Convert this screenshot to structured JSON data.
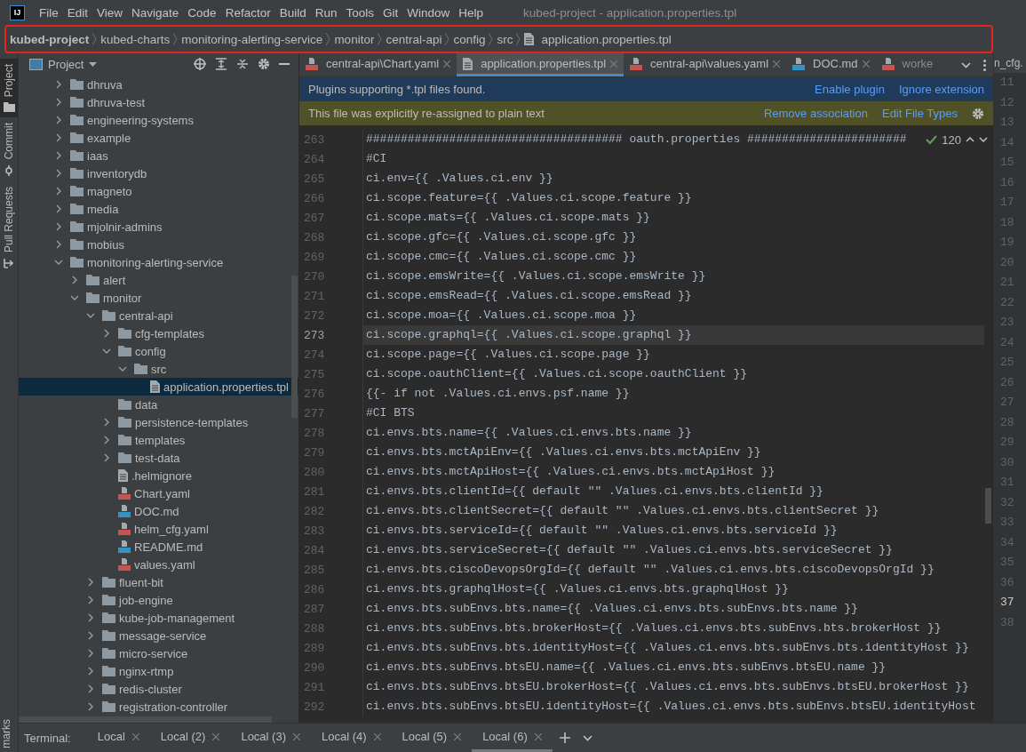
{
  "app_logo": "IJ",
  "menu": [
    "File",
    "Edit",
    "View",
    "Navigate",
    "Code",
    "Refactor",
    "Build",
    "Run",
    "Tools",
    "Git",
    "Window",
    "Help"
  ],
  "window": {
    "title": "kubed-project - application.properties.tpl"
  },
  "breadcrumb": [
    {
      "label": "kubed-project",
      "kind": "project"
    },
    {
      "label": "kubed-charts",
      "kind": "folder"
    },
    {
      "label": "monitoring-alerting-service",
      "kind": "folder"
    },
    {
      "label": "monitor",
      "kind": "folder"
    },
    {
      "label": "central-api",
      "kind": "folder"
    },
    {
      "label": "config",
      "kind": "folder"
    },
    {
      "label": "src",
      "kind": "folder"
    },
    {
      "label": "application.properties.tpl",
      "kind": "file"
    }
  ],
  "tool_windows": [
    {
      "label": "Project",
      "kind": "project",
      "selected": true
    },
    {
      "label": "Commit",
      "kind": "commit",
      "selected": false
    },
    {
      "label": "Pull Requests",
      "kind": "pull-requests",
      "selected": false
    }
  ],
  "bottom_tool_window": {
    "label": "marks"
  },
  "project": {
    "title": "Project",
    "tree": [
      {
        "label": "dhruva",
        "kind": "folder",
        "expanded": false,
        "selected": false
      },
      {
        "label": "dhruva-test",
        "kind": "folder",
        "expanded": false,
        "selected": false
      },
      {
        "label": "engineering-systems",
        "kind": "folder",
        "expanded": false,
        "selected": false
      },
      {
        "label": "example",
        "kind": "folder",
        "expanded": false,
        "selected": false
      },
      {
        "label": "iaas",
        "kind": "folder",
        "expanded": false,
        "selected": false
      },
      {
        "label": "inventorydb",
        "kind": "folder",
        "expanded": false,
        "selected": false
      },
      {
        "label": "magneto",
        "kind": "folder",
        "expanded": false,
        "selected": false
      },
      {
        "label": "media",
        "kind": "folder",
        "expanded": false,
        "selected": false
      },
      {
        "label": "mjolnir-admins",
        "kind": "folder",
        "expanded": false,
        "selected": false
      },
      {
        "label": "mobius",
        "kind": "folder",
        "expanded": false,
        "selected": false
      },
      {
        "label": "monitoring-alerting-service",
        "kind": "folder",
        "expanded": true,
        "selected": false,
        "children": [
          {
            "label": "alert",
            "kind": "folder",
            "expanded": false,
            "selected": false
          },
          {
            "label": "monitor",
            "kind": "folder",
            "expanded": true,
            "selected": false,
            "children": [
              {
                "label": "central-api",
                "kind": "folder",
                "expanded": true,
                "selected": false,
                "children": [
                  {
                    "label": "cfg-templates",
                    "kind": "folder",
                    "expanded": false,
                    "selected": false
                  },
                  {
                    "label": "config",
                    "kind": "folder",
                    "expanded": true,
                    "selected": false,
                    "children": [
                      {
                        "label": "src",
                        "kind": "folder",
                        "expanded": true,
                        "selected": false,
                        "children": [
                          {
                            "label": "application.properties.tpl",
                            "kind": "text",
                            "selected": true
                          }
                        ]
                      }
                    ]
                  },
                  {
                    "label": "data",
                    "kind": "empty-folder",
                    "selected": false
                  },
                  {
                    "label": "persistence-templates",
                    "kind": "folder",
                    "expanded": false,
                    "selected": false
                  },
                  {
                    "label": "templates",
                    "kind": "folder",
                    "expanded": false,
                    "selected": false
                  },
                  {
                    "label": "test-data",
                    "kind": "folder",
                    "expanded": false,
                    "selected": false
                  },
                  {
                    "label": ".helmignore",
                    "kind": "text",
                    "selected": false
                  },
                  {
                    "label": "Chart.yaml",
                    "kind": "yml",
                    "selected": false
                  },
                  {
                    "label": "DOC.md",
                    "kind": "md",
                    "selected": false
                  },
                  {
                    "label": "helm_cfg.yaml",
                    "kind": "yml",
                    "selected": false
                  },
                  {
                    "label": "README.md",
                    "kind": "md",
                    "selected": false
                  },
                  {
                    "label": "values.yaml",
                    "kind": "yml",
                    "selected": false
                  }
                ]
              },
              {
                "label": "fluent-bit",
                "kind": "folder",
                "expanded": false,
                "selected": false
              },
              {
                "label": "job-engine",
                "kind": "folder",
                "expanded": false,
                "selected": false
              },
              {
                "label": "kube-job-management",
                "kind": "folder",
                "expanded": false,
                "selected": false
              },
              {
                "label": "message-service",
                "kind": "folder",
                "expanded": false,
                "selected": false
              },
              {
                "label": "micro-service",
                "kind": "folder",
                "expanded": false,
                "selected": false
              },
              {
                "label": "nginx-rtmp",
                "kind": "folder",
                "expanded": false,
                "selected": false
              },
              {
                "label": "redis-cluster",
                "kind": "folder",
                "expanded": false,
                "selected": false
              },
              {
                "label": "registration-controller",
                "kind": "folder",
                "expanded": false,
                "selected": false
              }
            ]
          }
        ]
      }
    ]
  },
  "editor": {
    "tabs": [
      {
        "label": "central-api\\Chart.yaml",
        "kind": "yml",
        "selected": false
      },
      {
        "label": "application.properties.tpl",
        "kind": "text",
        "selected": true
      },
      {
        "label": "central-api\\values.yaml",
        "kind": "yml",
        "selected": false
      },
      {
        "label": "DOC.md",
        "kind": "md",
        "selected": false
      },
      {
        "label": "worke",
        "kind": "yml",
        "selected": false
      }
    ],
    "notifications": [
      {
        "kind": "info",
        "message": "Plugins supporting *.tpl files found.",
        "actions": [
          "Enable plugin",
          "Ignore extension"
        ]
      },
      {
        "kind": "warning",
        "message": "This file was explicitly re-assigned to plain text",
        "actions": [
          "Remove association",
          "Edit File Types"
        ],
        "settings": true
      }
    ],
    "inspection_count": "120",
    "lines": [
      {
        "number": "263",
        "text": "##################################### oauth.properties #######################",
        "current": false
      },
      {
        "number": "264",
        "text": "#CI",
        "current": false
      },
      {
        "number": "265",
        "text": "ci.env={{ .Values.ci.env }}",
        "current": false
      },
      {
        "number": "266",
        "text": "ci.scope.feature={{ .Values.ci.scope.feature }}",
        "current": false
      },
      {
        "number": "267",
        "text": "ci.scope.mats={{ .Values.ci.scope.mats }}",
        "current": false
      },
      {
        "number": "268",
        "text": "ci.scope.gfc={{ .Values.ci.scope.gfc }}",
        "current": false
      },
      {
        "number": "269",
        "text": "ci.scope.cmc={{ .Values.ci.scope.cmc }}",
        "current": false
      },
      {
        "number": "270",
        "text": "ci.scope.emsWrite={{ .Values.ci.scope.emsWrite }}",
        "current": false
      },
      {
        "number": "271",
        "text": "ci.scope.emsRead={{ .Values.ci.scope.emsRead }}",
        "current": false
      },
      {
        "number": "272",
        "text": "ci.scope.moa={{ .Values.ci.scope.moa }}",
        "current": false
      },
      {
        "number": "273",
        "text": "ci.scope.graphql={{ .Values.ci.scope.graphql }}",
        "current": true
      },
      {
        "number": "274",
        "text": "ci.scope.page={{ .Values.ci.scope.page }}",
        "current": false
      },
      {
        "number": "275",
        "text": "ci.scope.oauthClient={{ .Values.ci.scope.oauthClient }}",
        "current": false
      },
      {
        "number": "276",
        "text": "{{- if not .Values.ci.envs.psf.name }}",
        "current": false
      },
      {
        "number": "277",
        "text": "#CI BTS",
        "current": false
      },
      {
        "number": "278",
        "text": "ci.envs.bts.name={{ .Values.ci.envs.bts.name }}",
        "current": false
      },
      {
        "number": "279",
        "text": "ci.envs.bts.mctApiEnv={{ .Values.ci.envs.bts.mctApiEnv }}",
        "current": false
      },
      {
        "number": "280",
        "text": "ci.envs.bts.mctApiHost={{ .Values.ci.envs.bts.mctApiHost }}",
        "current": false
      },
      {
        "number": "281",
        "text": "ci.envs.bts.clientId={{ default \"\" .Values.ci.envs.bts.clientId }}",
        "current": false
      },
      {
        "number": "282",
        "text": "ci.envs.bts.clientSecret={{ default \"\" .Values.ci.envs.bts.clientSecret }}",
        "current": false
      },
      {
        "number": "283",
        "text": "ci.envs.bts.serviceId={{ default \"\" .Values.ci.envs.bts.serviceId }}",
        "current": false
      },
      {
        "number": "284",
        "text": "ci.envs.bts.serviceSecret={{ default \"\" .Values.ci.envs.bts.serviceSecret }}",
        "current": false
      },
      {
        "number": "285",
        "text": "ci.envs.bts.ciscoDevopsOrgId={{ default \"\" .Values.ci.envs.bts.ciscoDevopsOrgId }}",
        "current": false
      },
      {
        "number": "286",
        "text": "ci.envs.bts.graphqlHost={{ .Values.ci.envs.bts.graphqlHost }}",
        "current": false
      },
      {
        "number": "287",
        "text": "ci.envs.bts.subEnvs.bts.name={{ .Values.ci.envs.bts.subEnvs.bts.name }}",
        "current": false
      },
      {
        "number": "288",
        "text": "ci.envs.bts.subEnvs.bts.brokerHost={{ .Values.ci.envs.bts.subEnvs.bts.brokerHost }}",
        "current": false
      },
      {
        "number": "289",
        "text": "ci.envs.bts.subEnvs.bts.identityHost={{ .Values.ci.envs.bts.subEnvs.bts.identityHost }}",
        "current": false
      },
      {
        "number": "290",
        "text": "ci.envs.bts.subEnvs.btsEU.name={{ .Values.ci.envs.bts.subEnvs.btsEU.name }}",
        "current": false
      },
      {
        "number": "291",
        "text": "ci.envs.bts.subEnvs.btsEU.brokerHost={{ .Values.ci.envs.bts.subEnvs.btsEU.brokerHost }}",
        "current": false
      },
      {
        "number": "292",
        "text": "ci.envs.bts.subEnvs.btsEU.identityHost={{ .Values.ci.envs.bts.subEnvs.btsEU.identityHost",
        "current": false
      }
    ]
  },
  "split_editor": {
    "tab_fragment": "n_cfg.",
    "lines": [
      {
        "number": "11",
        "current": false
      },
      {
        "number": "12",
        "current": false
      },
      {
        "number": "13",
        "current": false
      },
      {
        "number": "14",
        "current": false
      },
      {
        "number": "15",
        "current": false
      },
      {
        "number": "16",
        "current": false
      },
      {
        "number": "17",
        "current": false
      },
      {
        "number": "18",
        "current": false
      },
      {
        "number": "19",
        "current": false
      },
      {
        "number": "20",
        "current": false
      },
      {
        "number": "21",
        "current": false
      },
      {
        "number": "22",
        "current": false
      },
      {
        "number": "23",
        "current": false
      },
      {
        "number": "24",
        "current": false
      },
      {
        "number": "25",
        "current": false
      },
      {
        "number": "26",
        "current": false
      },
      {
        "number": "27",
        "current": false
      },
      {
        "number": "28",
        "current": false
      },
      {
        "number": "29",
        "current": false
      },
      {
        "number": "30",
        "current": false
      },
      {
        "number": "31",
        "current": false
      },
      {
        "number": "32",
        "current": false
      },
      {
        "number": "33",
        "current": false
      },
      {
        "number": "34",
        "current": false
      },
      {
        "number": "35",
        "current": false
      },
      {
        "number": "36",
        "current": false
      },
      {
        "number": "37",
        "current": true
      },
      {
        "number": "38",
        "current": false
      }
    ]
  },
  "terminal": {
    "label": "Terminal:",
    "tabs": [
      {
        "label": "Local",
        "selected": false
      },
      {
        "label": "Local (2)",
        "selected": false
      },
      {
        "label": "Local (3)",
        "selected": false
      },
      {
        "label": "Local (4)",
        "selected": false
      },
      {
        "label": "Local (5)",
        "selected": false
      },
      {
        "label": "Local (6)",
        "selected": true
      }
    ]
  }
}
